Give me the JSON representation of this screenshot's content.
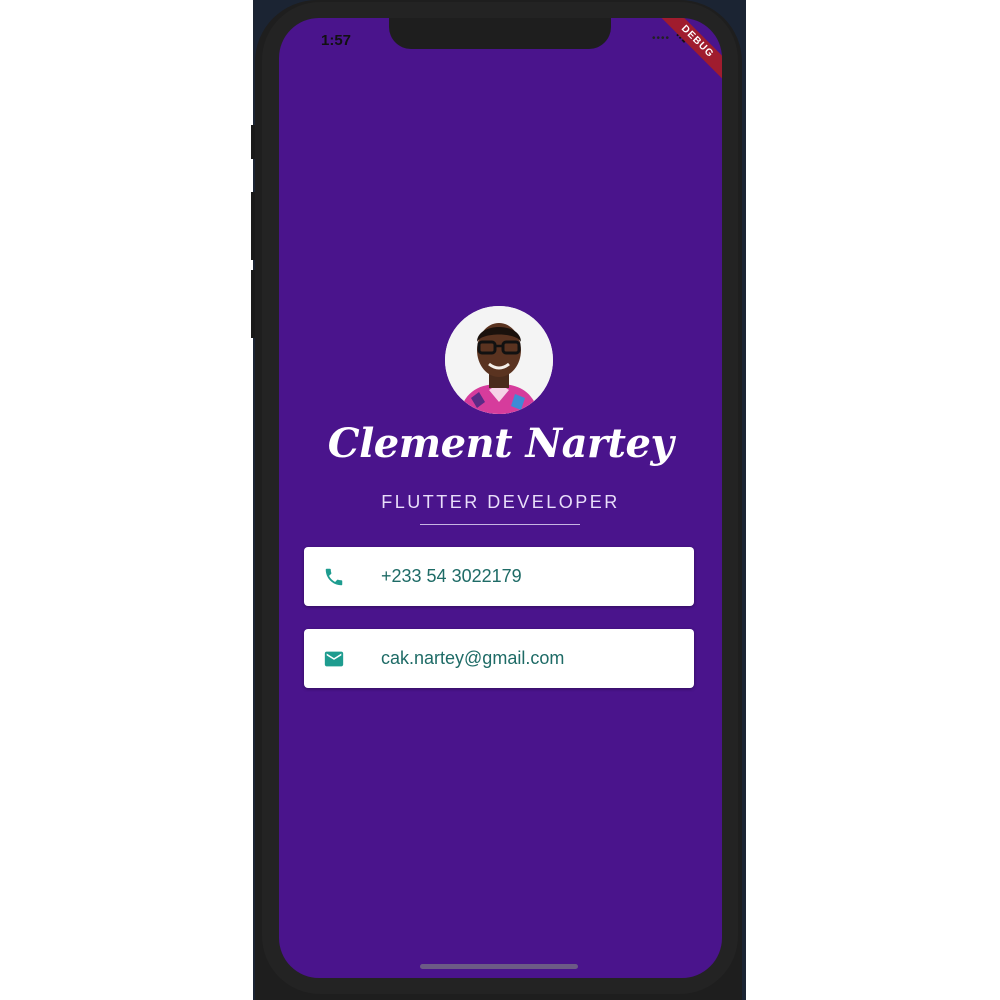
{
  "status_bar": {
    "time": "1:57",
    "debug_banner": "DEBUG"
  },
  "profile": {
    "name": "Clement Nartey",
    "title": "FLUTTER DEVELOPER",
    "avatar_icon": "profile-photo"
  },
  "contacts": [
    {
      "icon": "phone-icon",
      "value": "+233 54 3022179"
    },
    {
      "icon": "mail-icon",
      "value": "cak.nartey@gmail.com"
    }
  ],
  "colors": {
    "background": "#4a148c",
    "card": "#ffffff",
    "accent_teal": "#1e9c8f",
    "text_teal": "#1e6b66",
    "debug_ribbon": "#a01c2e"
  }
}
